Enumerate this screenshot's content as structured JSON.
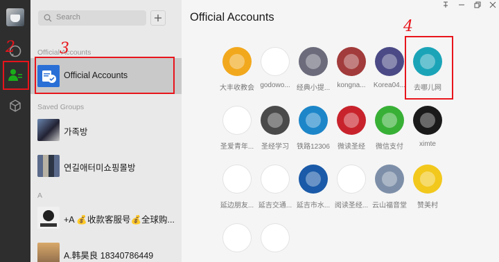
{
  "search": {
    "placeholder": "Search"
  },
  "mid": {
    "official_label": "Official Accounts",
    "selected_item": "Official Accounts",
    "saved_groups_label": "Saved Groups",
    "groups": [
      "가족방",
      "연길애터미쇼핑몰방"
    ],
    "letter_a": "A",
    "contacts": [
      "+A 💰收款客服号💰全球购...",
      "A.韩昊良 18340786449"
    ]
  },
  "main": {
    "title": "Official Accounts",
    "accounts": [
      {
        "label": "大丰收教会",
        "color": "#f2a81d"
      },
      {
        "label": "godowo...",
        "color": "#ffffff"
      },
      {
        "label": "经典小提...",
        "color": "#6b6b7b"
      },
      {
        "label": "kongna...",
        "color": "#a23b3b"
      },
      {
        "label": "Korea04...",
        "color": "#4b4a86"
      },
      {
        "label": "去哪儿网",
        "color": "#1ba4b8"
      },
      {
        "label": "圣爱青年...",
        "color": "#ffffff"
      },
      {
        "label": "圣经学习",
        "color": "#4a4a4a"
      },
      {
        "label": "铁路12306",
        "color": "#1d86c9"
      },
      {
        "label": "微读圣经",
        "color": "#c8232c"
      },
      {
        "label": "微信支付",
        "color": "#38b036"
      },
      {
        "label": "ximte",
        "color": "#1a1a1a"
      },
      {
        "label": "延边朋友...",
        "color": "#ffffff"
      },
      {
        "label": "延吉交通...",
        "color": "#ffffff"
      },
      {
        "label": "延吉市水...",
        "color": "#1a5aa8"
      },
      {
        "label": "阅读圣经...",
        "color": "#ffffff"
      },
      {
        "label": "云山福音堂",
        "color": "#7d8fa8"
      },
      {
        "label": "赞美村",
        "color": "#f2c81d"
      },
      {
        "label": "",
        "color": "#ffffff"
      },
      {
        "label": "",
        "color": "#ffffff"
      }
    ]
  },
  "annotations": [
    "2",
    "3",
    "4"
  ],
  "icons": {
    "contacts": "contacts-icon",
    "chat": "chat-icon",
    "cube": "cube-icon",
    "search": "search-icon",
    "plus": "plus-icon"
  },
  "colors": {
    "accent_red": "#e8141b",
    "rail": "#2e2e2e",
    "selected": "#c9c9c9"
  }
}
